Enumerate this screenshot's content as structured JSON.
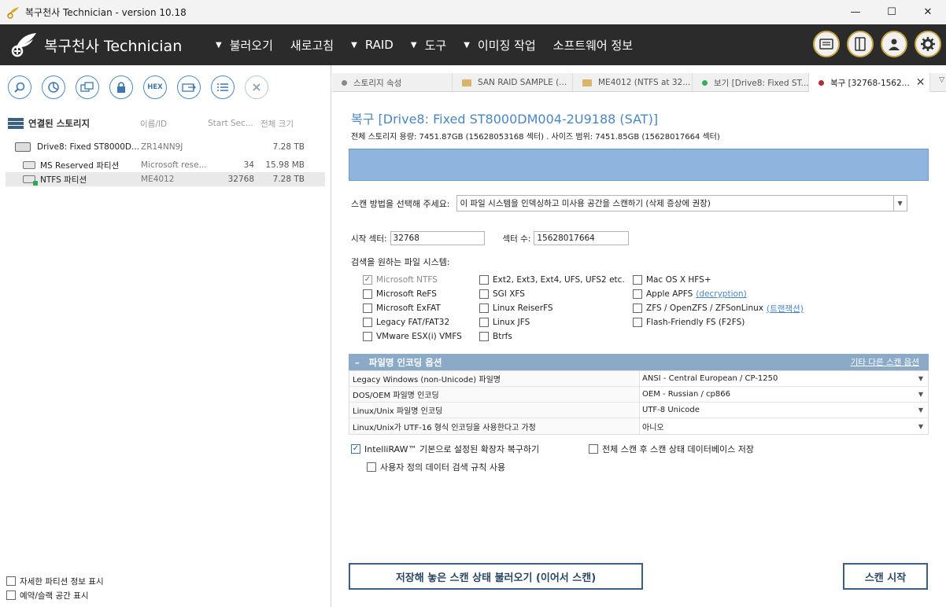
{
  "window": {
    "title": "복구천사 Technician - version 10.18",
    "minimize": "—",
    "maximize": "☐",
    "close": "✕"
  },
  "menubar": {
    "logo_text": "복구천사 Technician",
    "items": [
      {
        "label": "불러오기",
        "arrow": "▼"
      },
      {
        "label": "새로고침",
        "arrow": ""
      },
      {
        "label": "RAID",
        "arrow": "▼"
      },
      {
        "label": "도구",
        "arrow": "▼"
      },
      {
        "label": "이미징 작업",
        "arrow": "▼"
      },
      {
        "label": "소프트웨어 정보",
        "arrow": ""
      }
    ],
    "right_icons": [
      "card-icon",
      "panels-icon",
      "user-icon",
      "settings-icon"
    ]
  },
  "left": {
    "toolbar": [
      {
        "icon": "search-icon"
      },
      {
        "icon": "chart-icon"
      },
      {
        "icon": "copy-icon"
      },
      {
        "icon": "lock-icon"
      },
      {
        "icon": "hex-icon",
        "label": "HEX"
      },
      {
        "icon": "export-icon"
      },
      {
        "icon": "list-icon"
      },
      {
        "icon": "close-icon"
      }
    ],
    "storage_header": {
      "label": "연결된 스토리지",
      "col_name": "이름/ID",
      "col_start": "Start Sec...",
      "col_size": "전체 크기"
    },
    "rows": [
      {
        "name": "Drive8: Fixed ST8000D...",
        "id": "ZR14NN9J",
        "start": "",
        "size": "7.28 TB"
      },
      {
        "name": "MS Reserved 파티션",
        "id": "Microsoft rese...",
        "start": "34",
        "size": "15.98 MB"
      },
      {
        "name": "NTFS 파티션",
        "id": "ME4012",
        "start": "32768",
        "size": "7.28 TB"
      }
    ],
    "bottom_checks": [
      {
        "label": "자세한 파티션 정보 표시"
      },
      {
        "label": "예약/슬랙 공간 표시"
      }
    ]
  },
  "tabs": [
    {
      "label": "스토리지 속성",
      "type": "dot",
      "color": "#888888"
    },
    {
      "label": "SAN RAID SAMPLE (...",
      "type": "folder"
    },
    {
      "label": "ME4012 (NTFS at 32...",
      "type": "folder"
    },
    {
      "label": "보기 [Drive8: Fixed ST...",
      "type": "dot",
      "color": "#2fb05a"
    },
    {
      "label": "복구 [32768-1562...",
      "type": "dot",
      "color": "#b03030",
      "close": "✕"
    }
  ],
  "tab_menu": "▽",
  "recovery": {
    "title": "복구 [Drive8: Fixed ST8000DM004-2U9188 (SAT)]",
    "info": "전체 스토리지 용량: 7451.87GB (15628053168 섹터) . 사이즈 범위: 7451.85GB (15628017664 섹터)",
    "scan_label": "스캔 방법을 선택해 주세요:",
    "scan_value": "이 파일 시스템을 인덱싱하고 미사용 공간을 스캔하기 (삭제 증상에 권장)",
    "start_label": "시작 섹터:",
    "start_value": "32768",
    "count_label": "섹터 수:",
    "count_value": "15628017664",
    "fs_title": "검색을 원하는 파일 시스템:",
    "fs_columns": [
      [
        {
          "label": "Microsoft NTFS",
          "checked": "✓",
          "disabled": true
        },
        {
          "label": "Microsoft ReFS"
        },
        {
          "label": "Microsoft ExFAT"
        },
        {
          "label": "Legacy FAT/FAT32"
        },
        {
          "label": "VMware ESX(i) VMFS"
        }
      ],
      [
        {
          "label": "Ext2, Ext3, Ext4, UFS, UFS2 etc."
        },
        {
          "label": "SGI XFS"
        },
        {
          "label": "Linux ReiserFS"
        },
        {
          "label": "Linux JFS"
        },
        {
          "label": "Btrfs"
        }
      ],
      [
        {
          "label": "Mac OS X HFS+"
        },
        {
          "label": "Apple APFS",
          "link": "(decryption)"
        },
        {
          "label": "ZFS / OpenZFS / ZFSonLinux",
          "link": "(트랜잭션)"
        },
        {
          "label": "Flash-Friendly FS (F2FS)"
        }
      ]
    ],
    "encoding": {
      "minus": "–",
      "title": "파일명 인코딩 옵션",
      "other": "기타 다른 스캔 옵션",
      "rows": [
        {
          "key": "Legacy Windows (non-Unicode) 파일명",
          "value": "ANSI - Central European / CP-1250"
        },
        {
          "key": "DOS/OEM 파일명 인코딩",
          "value": "OEM - Russian / cp866"
        },
        {
          "key": "Linux/Unix 파일명 인코딩",
          "value": "UTF-8 Unicode"
        },
        {
          "key": "Linux/Unix가 UTF-16 형식 인코딩을 사용한다고 가정",
          "value": "아니오"
        }
      ]
    },
    "options": {
      "intelliraw": "IntelliRAW™ 기본으로 설정된 확장자 복구하기",
      "intelliraw_check": "✓",
      "save_db": "전체 스캔 후 스캔 상태 데이터베이스 저장",
      "custom_rules": "사용자 정의 데이터 검색 규칙 사용"
    },
    "buttons": {
      "load_state": "저장해 놓은 스캔 상태 불러오기 (이어서 스캔)",
      "start_scan": "스캔 시작"
    }
  },
  "colors": {
    "accent": "#4a86c4",
    "menubar": "#2b2b2b",
    "progress": "#8fb5de",
    "encoding_header": "#8aaac8"
  }
}
